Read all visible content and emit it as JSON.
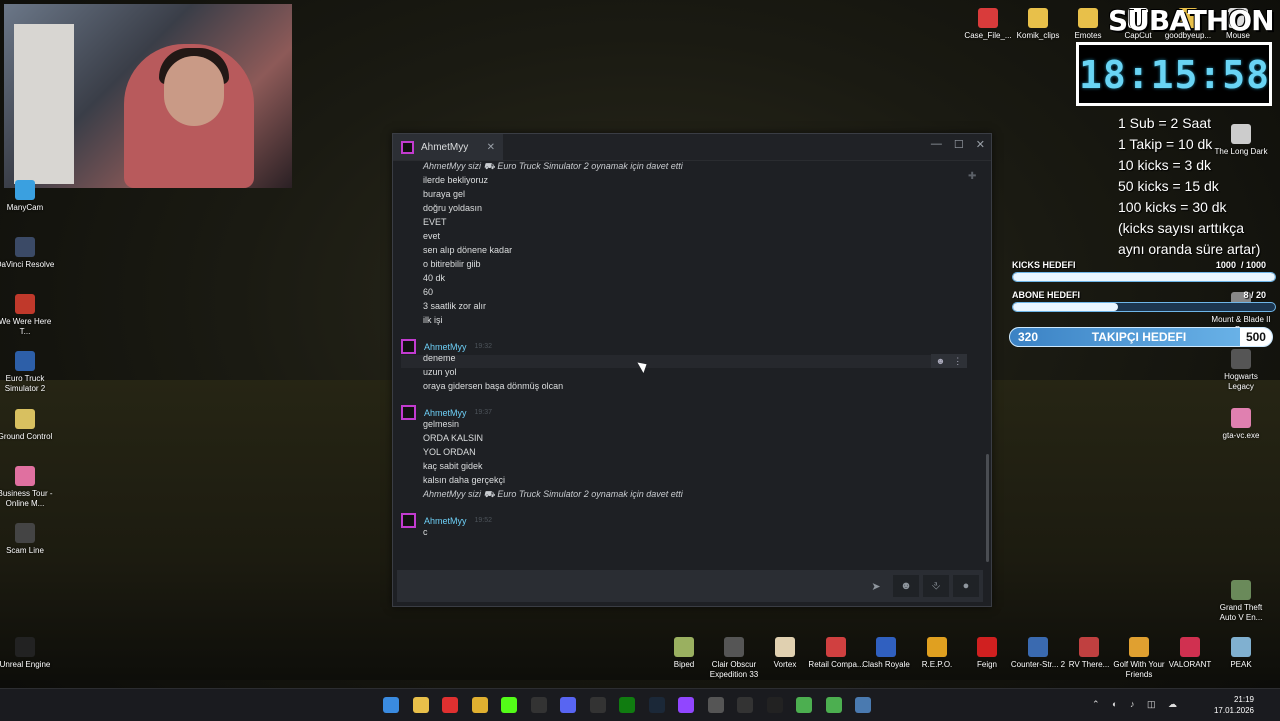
{
  "overlay": {
    "subathon_title": "SUBATHON",
    "timer": "18:15:58",
    "rules": [
      "1 Sub = 2 Saat",
      "1 Takip = 10 dk",
      "10 kicks = 3 dk",
      "50 kicks = 15 dk",
      "100 kicks = 30 dk",
      "(kicks sayısı arttıkça",
      "aynı oranda süre artar)"
    ],
    "kicks_goal": {
      "label": "KICKS HEDEFI",
      "current": "1000",
      "target": "/ 1000",
      "progress": 1.0
    },
    "sub_goal": {
      "label": "ABONE HEDEFI",
      "current": "8",
      "target": "/ 20",
      "progress": 0.4
    },
    "follow_goal": {
      "current": "320",
      "label": "TAKIPÇI HEDEFI",
      "target": "500"
    }
  },
  "chat": {
    "tab_name": "AhmetMyy",
    "groups": [
      {
        "lines": [
          {
            "text": "AhmetMyy sizi  ⛟ Euro Truck Simulator 2 oynamak için davet etti",
            "system": true
          },
          {
            "text": "ilerde bekliyoruz"
          },
          {
            "text": "buraya gel"
          },
          {
            "text": "doğru yoldasın"
          },
          {
            "text": "EVET"
          },
          {
            "text": "evet"
          },
          {
            "text": "sen alıp dönene kadar"
          },
          {
            "text": "o bitirebilir giib"
          },
          {
            "text": "40 dk"
          },
          {
            "text": "60"
          },
          {
            "text": "3 saatlik zor alır"
          },
          {
            "text": "ilk işi"
          }
        ]
      },
      {
        "author": "AhmetMyy",
        "time": "19:32",
        "lines": [
          {
            "text": "deneme"
          },
          {
            "text": "uzun yol"
          },
          {
            "text": "oraya gidersen başa dönmüş olcan"
          }
        ]
      },
      {
        "author": "AhmetMyy",
        "time": "19:37",
        "lines": [
          {
            "text": "gelmesin"
          },
          {
            "text": "ORDA KALSIN"
          },
          {
            "text": "YOL ORDAN"
          },
          {
            "text": "kaç sabit gidek"
          },
          {
            "text": "kalsın daha gerçekçi"
          },
          {
            "text": "AhmetMyy sizi  ⛟ Euro Truck Simulator 2 oynamak için davet etti",
            "system": true
          }
        ]
      },
      {
        "author": "AhmetMyy",
        "time": "19:52",
        "lines": [
          {
            "text": "c"
          }
        ]
      }
    ],
    "input_placeholder": ""
  },
  "desktop_left": [
    {
      "label": "ManyCam",
      "color": "#3aa0e0"
    },
    {
      "label": "DaVinci Resolve",
      "color": "#3b4a66"
    },
    {
      "label": "We Were Here T...",
      "color": "#c0392b"
    },
    {
      "label": "Euro Truck Simulator 2",
      "color": "#2d5fa8"
    },
    {
      "label": "Ground Control",
      "color": "#d8c060"
    },
    {
      "label": "Business Tour - Online M...",
      "color": "#e070a0"
    },
    {
      "label": "Scam Line",
      "color": "#444"
    },
    {
      "label": "Unreal Engine",
      "color": "#222"
    }
  ],
  "desktop_top": [
    {
      "label": "Case_File_...",
      "color": "#d93b3b"
    },
    {
      "label": "Komik_clips",
      "color": "#e8c04a"
    },
    {
      "label": "Emotes",
      "color": "#e8c04a"
    },
    {
      "label": "CapCut",
      "color": "#fff"
    },
    {
      "label": "goodbyeup...",
      "color": "#e8c04a"
    },
    {
      "label": "Mouse",
      "color": "#ddd"
    }
  ],
  "desktop_right": [
    {
      "label": "The Long Dark",
      "color": "#ccc"
    },
    {
      "label": "Mount & Blade II B...",
      "color": "#888"
    },
    {
      "label": "Hogwarts Legacy",
      "color": "#555"
    },
    {
      "label": "gta-vc.exe",
      "color": "#e080b0"
    },
    {
      "label": "Grand Theft Auto V En...",
      "color": "#6a8a5a"
    }
  ],
  "desktop_bottom": [
    {
      "label": "Biped",
      "color": "#9ab060"
    },
    {
      "label": "Clair Obscur Expedition 33",
      "color": "#555"
    },
    {
      "label": "Vortex",
      "color": "#e0d0b0"
    },
    {
      "label": "Retail Compa...",
      "color": "#d04040"
    },
    {
      "label": "Clash Royale",
      "color": "#3060c0"
    },
    {
      "label": "R.E.P.O.",
      "color": "#e0a020"
    },
    {
      "label": "Feign",
      "color": "#d02020"
    },
    {
      "label": "Counter-Str... 2",
      "color": "#3a6ab0"
    },
    {
      "label": "RV There...",
      "color": "#c04040"
    },
    {
      "label": "Golf With Your Friends",
      "color": "#e0a030"
    },
    {
      "label": "VALORANT",
      "color": "#d03050"
    },
    {
      "label": "PEAK",
      "color": "#80b0d0"
    }
  ],
  "taskbar": {
    "clock_time": "21:19",
    "clock_date": "17.01.2026",
    "icons": [
      "windows-icon",
      "file-explorer-icon",
      "youtube-music-icon",
      "chrome-icon",
      "kick-icon",
      "obs-icon",
      "discord-icon",
      "stream-deck-icon",
      "xbox-icon",
      "steam-icon",
      "twitch-icon",
      "unity-icon",
      "epic-icon",
      "unreal-icon",
      "chrome-icon",
      "chrome-icon",
      "app-icon"
    ]
  }
}
